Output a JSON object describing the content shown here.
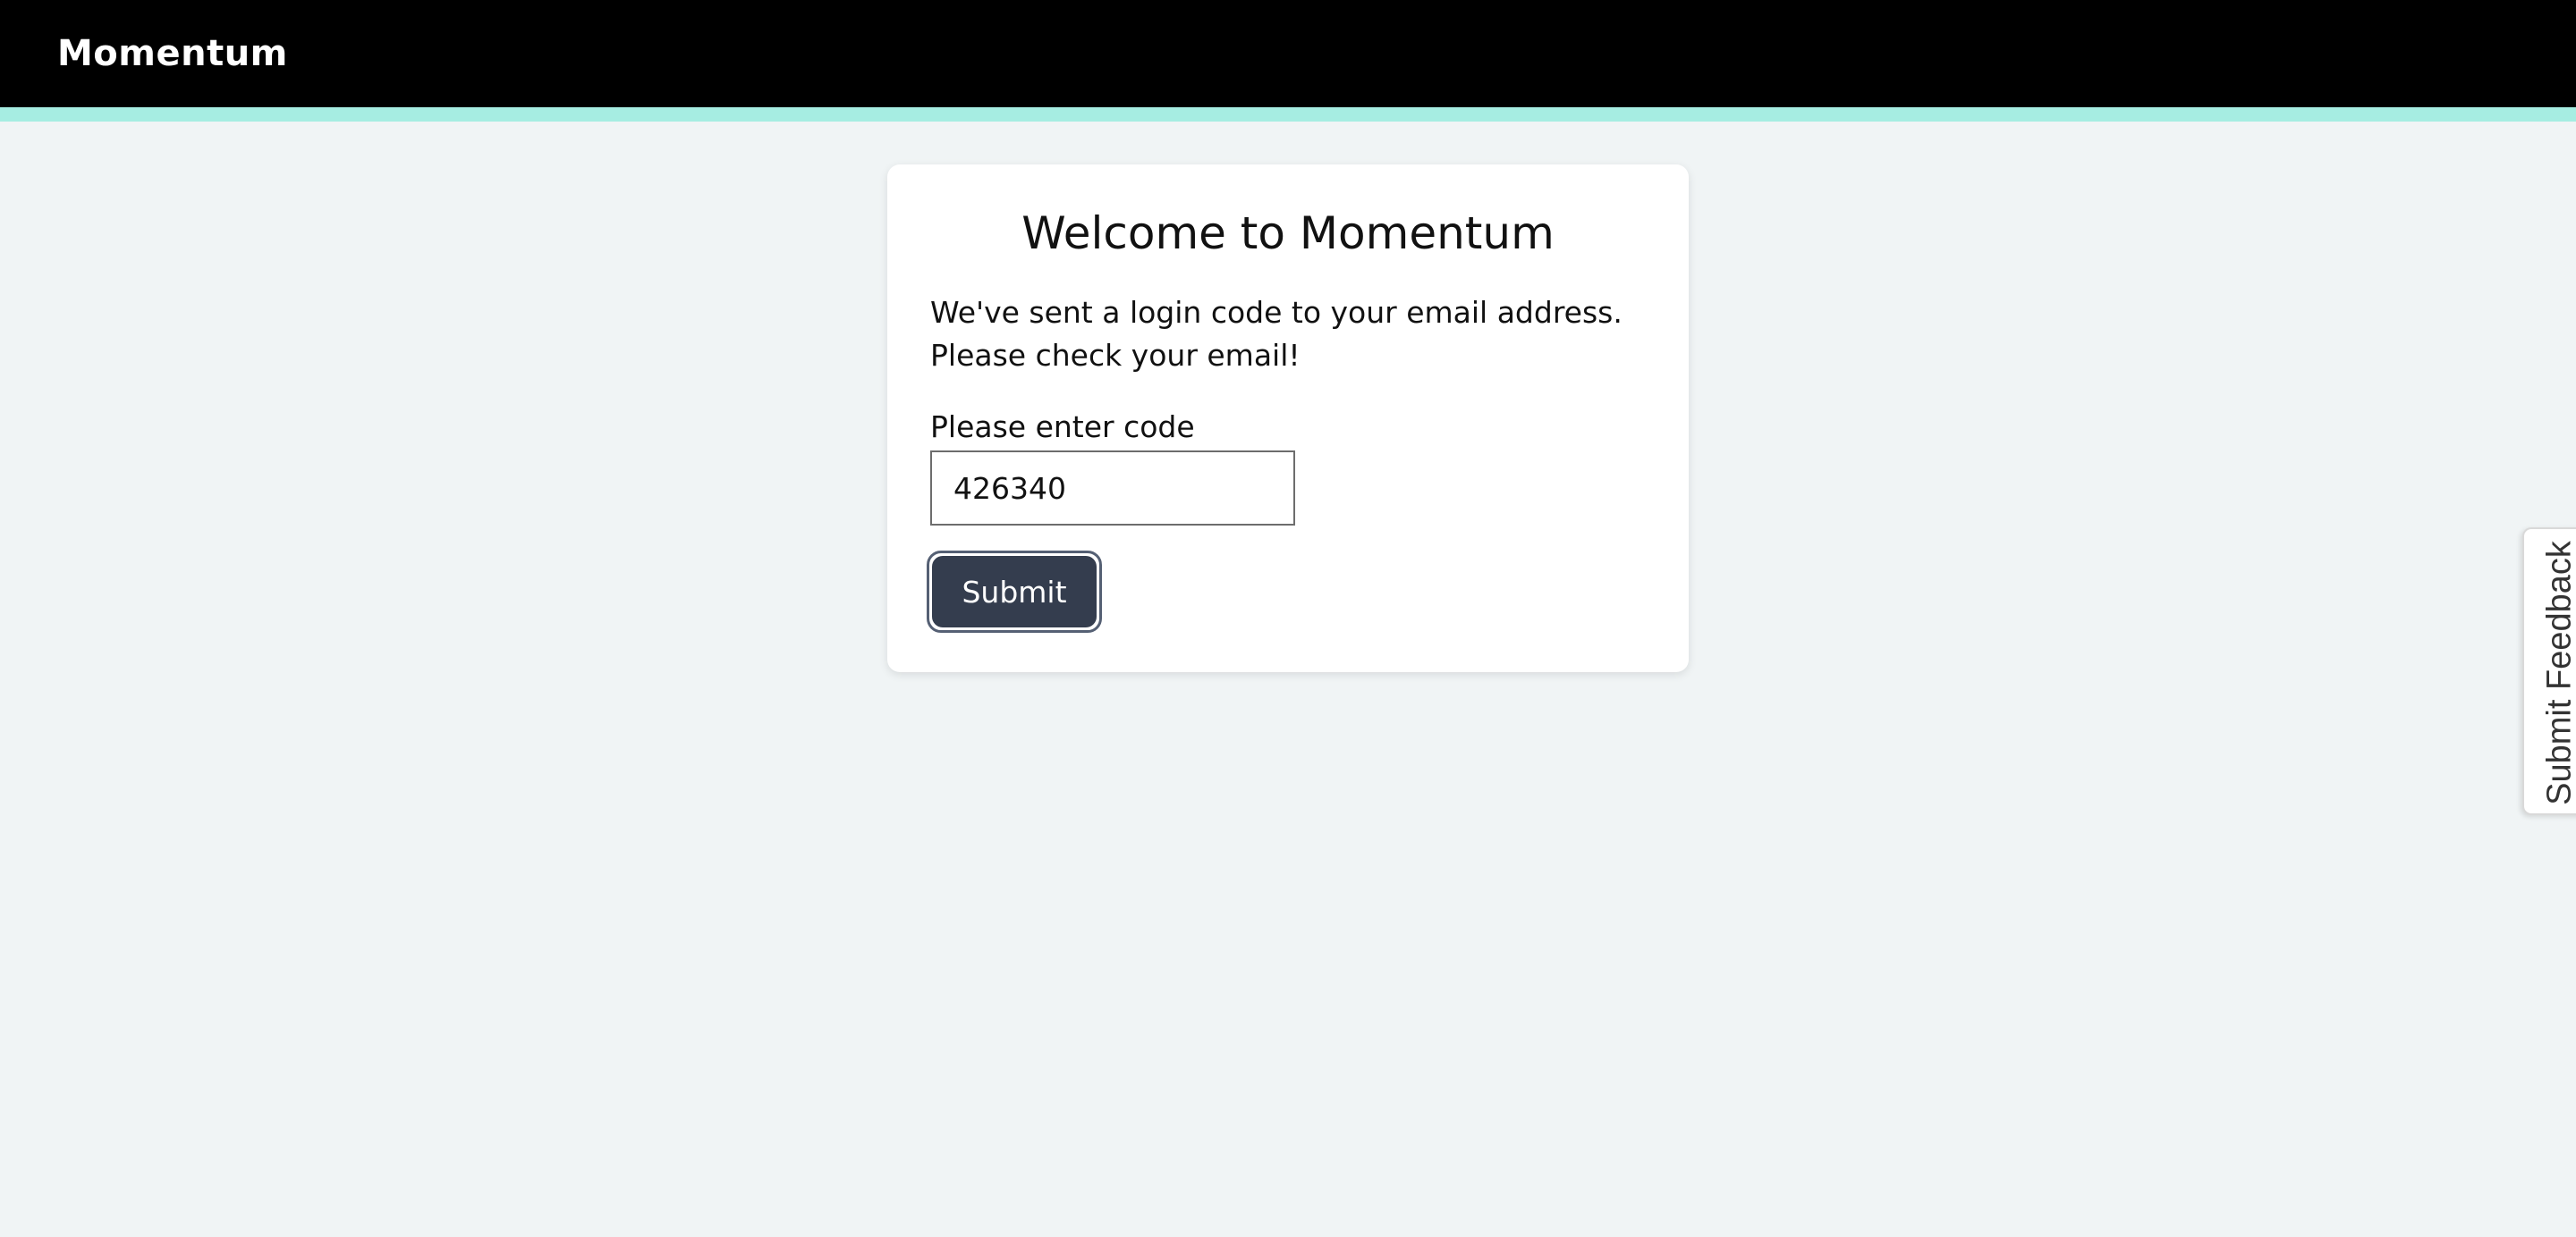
{
  "header": {
    "brand": "Momentum"
  },
  "login": {
    "title": "Welcome to Momentum",
    "message": "We've sent a login code to your email address. Please check your email!",
    "code_label": "Please enter code",
    "code_value": "426340",
    "submit_label": "Submit"
  },
  "feedback": {
    "label": "Submit Feedback"
  },
  "colors": {
    "header_bg": "#000000",
    "accent_stripe": "#a6ede2",
    "page_bg": "#f0f4f5",
    "button_bg": "#343d4e"
  }
}
